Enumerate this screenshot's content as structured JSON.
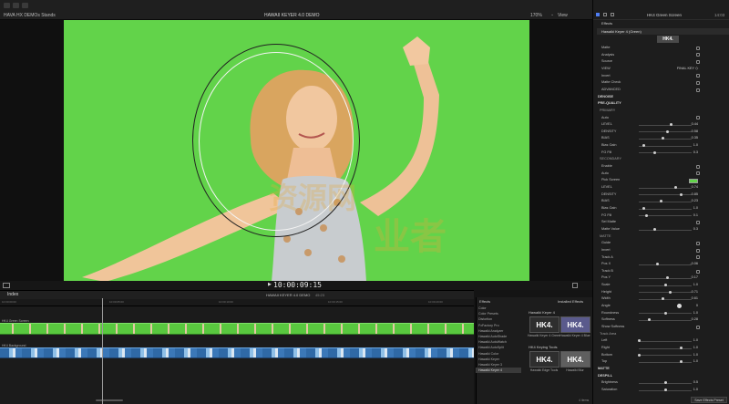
{
  "colors": {
    "green_screen": "#62d34a",
    "accent_blue": "#4f7df2",
    "hk4_dark": "#2e2e2e",
    "hk4_purple": "#5a5a8c",
    "clip_green": "#59c93f",
    "clip_blue": "#3b78b8"
  },
  "topbar": {
    "library_label": "HAVA HX DEMOs Stands",
    "project_title": "HAWAII KEYER 4.0 DEMO",
    "zoom_label": "170%",
    "view_label": "View"
  },
  "transport": {
    "timecode": "10:00:09:15"
  },
  "timeline": {
    "index_tab": "Index",
    "project_name": "HAWAII KEYER 4.0 DEMO",
    "duration": "45:23",
    "track_top_label": "HK4 Green Screen",
    "track_bottom_label": "HK4 Background",
    "ruler_marks": [
      "10:00:00:00",
      "10:00:05:00",
      "10:00:10:00",
      "10:00:15:00",
      "10:00:20:00"
    ]
  },
  "effects_browser": {
    "title": "Effects",
    "installed_label": "Installed Effects",
    "categories": [
      "Color",
      "Color Presets",
      "Distortion",
      "FxFactory Pro",
      "Hawaiki Analyzer",
      "Hawaiki AutoShade",
      "Hawaiki AutoWatch",
      "Hawaiki AutoSplit",
      "Hawaiki Color",
      "Hawaiki Keyer",
      "Hawaiki Keyer 3",
      "Hawaiki Keyer 4"
    ],
    "section_keyer": "Hawaiki Keyer 4",
    "section_tools": "HK4 Keying Tools",
    "thumbs": [
      {
        "text": "HK4.",
        "label": "Hawaiki Keyer 4 Green"
      },
      {
        "text": "HK4.",
        "label": "Hawaiki Keyer 4 Blue"
      },
      {
        "text": "HK4.",
        "label": "Hawaiki Edge Tools"
      },
      {
        "text": "HK4.",
        "label": "Hawaiki Blur"
      }
    ],
    "items_count": "4 items"
  },
  "inspector": {
    "tab_title": "HK4 Green Screen",
    "timecode": "14:03",
    "effects_header": "Effects",
    "effect_name": "Hawaiki Keyer 4 (Green)",
    "logo_text": "HK4.",
    "rows": [
      {
        "type": "check",
        "label": "Matte"
      },
      {
        "type": "check",
        "label": "Analysis"
      },
      {
        "type": "check",
        "label": "Source"
      },
      {
        "type": "value",
        "label": "VIEW",
        "value": "FINAL KEY ◇"
      },
      {
        "type": "check",
        "label": "Invert"
      },
      {
        "type": "check",
        "label": "Matte Check"
      },
      {
        "type": "check",
        "label": "ADVANCED"
      },
      {
        "type": "section",
        "label": "DENOISE"
      },
      {
        "type": "section",
        "label": "PRE-QUALITY"
      },
      {
        "type": "group",
        "label": "PRIMARY"
      },
      {
        "type": "check",
        "label": "Auto"
      },
      {
        "type": "slider",
        "label": "LEVEL",
        "value": "0.44",
        "pos": 0.62
      },
      {
        "type": "slider",
        "label": "DENSITY",
        "value": "0.58",
        "pos": 0.55
      },
      {
        "type": "slider",
        "label": "BIAS",
        "value": "0.35",
        "pos": 0.45
      },
      {
        "type": "slider",
        "label": "Bias Gain",
        "value": "1.0",
        "pos": 0.1
      },
      {
        "type": "slider",
        "label": "FG Fill",
        "value": "0.3",
        "pos": 0.3
      },
      {
        "type": "group",
        "label": "SECONDARY"
      },
      {
        "type": "check",
        "label": "Enable"
      },
      {
        "type": "check",
        "label": "Auto"
      },
      {
        "type": "swatch",
        "label": "Pick Screen"
      },
      {
        "type": "slider",
        "label": "LEVEL",
        "value": "0.74",
        "pos": 0.7
      },
      {
        "type": "slider",
        "label": "DENSITY",
        "value": "0.85",
        "pos": 0.8
      },
      {
        "type": "slider",
        "label": "BIAS",
        "value": "0.23",
        "pos": 0.42
      },
      {
        "type": "slider",
        "label": "Bias Gain",
        "value": "1.0",
        "pos": 0.1
      },
      {
        "type": "slider",
        "label": "FG Fill",
        "value": "0.1",
        "pos": 0.15
      },
      {
        "type": "check",
        "label": "Sel Matte"
      },
      {
        "type": "slider",
        "label": "Matte Value",
        "value": "0.3",
        "pos": 0.3
      },
      {
        "type": "group",
        "label": "MATTE"
      },
      {
        "type": "check",
        "label": "Guide"
      },
      {
        "type": "check",
        "label": "Invert"
      },
      {
        "type": "check",
        "label": "Track A"
      },
      {
        "type": "slider",
        "label": "Pos X",
        "value": "-0.06",
        "pos": 0.35
      },
      {
        "type": "check",
        "label": "Track B"
      },
      {
        "type": "slider",
        "label": "Pos Y",
        "value": "0.17",
        "pos": 0.55
      },
      {
        "type": "slider",
        "label": "Scale",
        "value": "1.0",
        "pos": 0.5
      },
      {
        "type": "slider",
        "label": "Height",
        "value": "0.71",
        "pos": 0.6
      },
      {
        "type": "slider",
        "label": "Width",
        "value": "0.61",
        "pos": 0.45
      },
      {
        "type": "angle",
        "label": "Angle",
        "value": "0"
      },
      {
        "type": "slider",
        "label": "Roundness",
        "value": "1.0",
        "pos": 0.5
      },
      {
        "type": "slider",
        "label": "Softness",
        "value": "0.28",
        "pos": 0.2
      },
      {
        "type": "check",
        "label": "Show Softness"
      },
      {
        "type": "group",
        "label": "Track Area"
      },
      {
        "type": "slider",
        "label": "Left",
        "value": "1.0",
        "pos": 0.0
      },
      {
        "type": "slider",
        "label": "Right",
        "value": "1.0",
        "pos": 0.8
      },
      {
        "type": "slider",
        "label": "Bottom",
        "value": "1.0",
        "pos": 0.0
      },
      {
        "type": "slider",
        "label": "Top",
        "value": "1.0",
        "pos": 0.8
      },
      {
        "type": "section",
        "label": "MATTE"
      },
      {
        "type": "section",
        "label": "DESPILL"
      },
      {
        "type": "slider",
        "label": "Brightness",
        "value": "0.5",
        "pos": 0.5
      },
      {
        "type": "slider",
        "label": "Saturation",
        "value": "1.0",
        "pos": 0.5
      }
    ],
    "save_preset": "Save Effects Preset"
  },
  "watermark": {
    "line1": "资源网",
    "line2": "业者"
  }
}
